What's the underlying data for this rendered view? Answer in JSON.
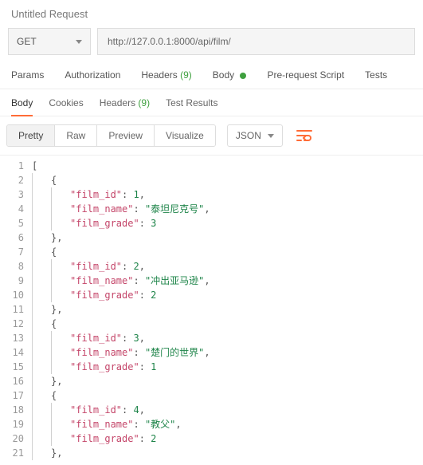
{
  "title": "Untitled Request",
  "request": {
    "method": "GET",
    "url": "http://127.0.0.1:8000/api/film/"
  },
  "reqTabs": {
    "params": "Params",
    "authorization": "Authorization",
    "headers": "Headers",
    "headersCount": "(9)",
    "body": "Body",
    "preRequest": "Pre-request Script",
    "tests": "Tests"
  },
  "respTabs": {
    "body": "Body",
    "cookies": "Cookies",
    "headers": "Headers",
    "headersCount": "(9)",
    "testResults": "Test Results"
  },
  "viewToolbar": {
    "pretty": "Pretty",
    "raw": "Raw",
    "preview": "Preview",
    "visualize": "Visualize",
    "format": "JSON"
  },
  "code": {
    "k_id": "\"film_id\"",
    "k_name": "\"film_name\"",
    "k_grade": "\"film_grade\"",
    "colon": ": ",
    "comma": ",",
    "openArr": "[",
    "openObj": "{",
    "closeObj": "},",
    "items": [
      {
        "id": "1",
        "name": "\"泰坦尼克号\"",
        "grade": "3"
      },
      {
        "id": "2",
        "name": "\"冲出亚马逊\"",
        "grade": "2"
      },
      {
        "id": "3",
        "name": "\"楚门的世界\"",
        "grade": "1"
      },
      {
        "id": "4",
        "name": "\"教父\"",
        "grade": "2"
      }
    ]
  }
}
